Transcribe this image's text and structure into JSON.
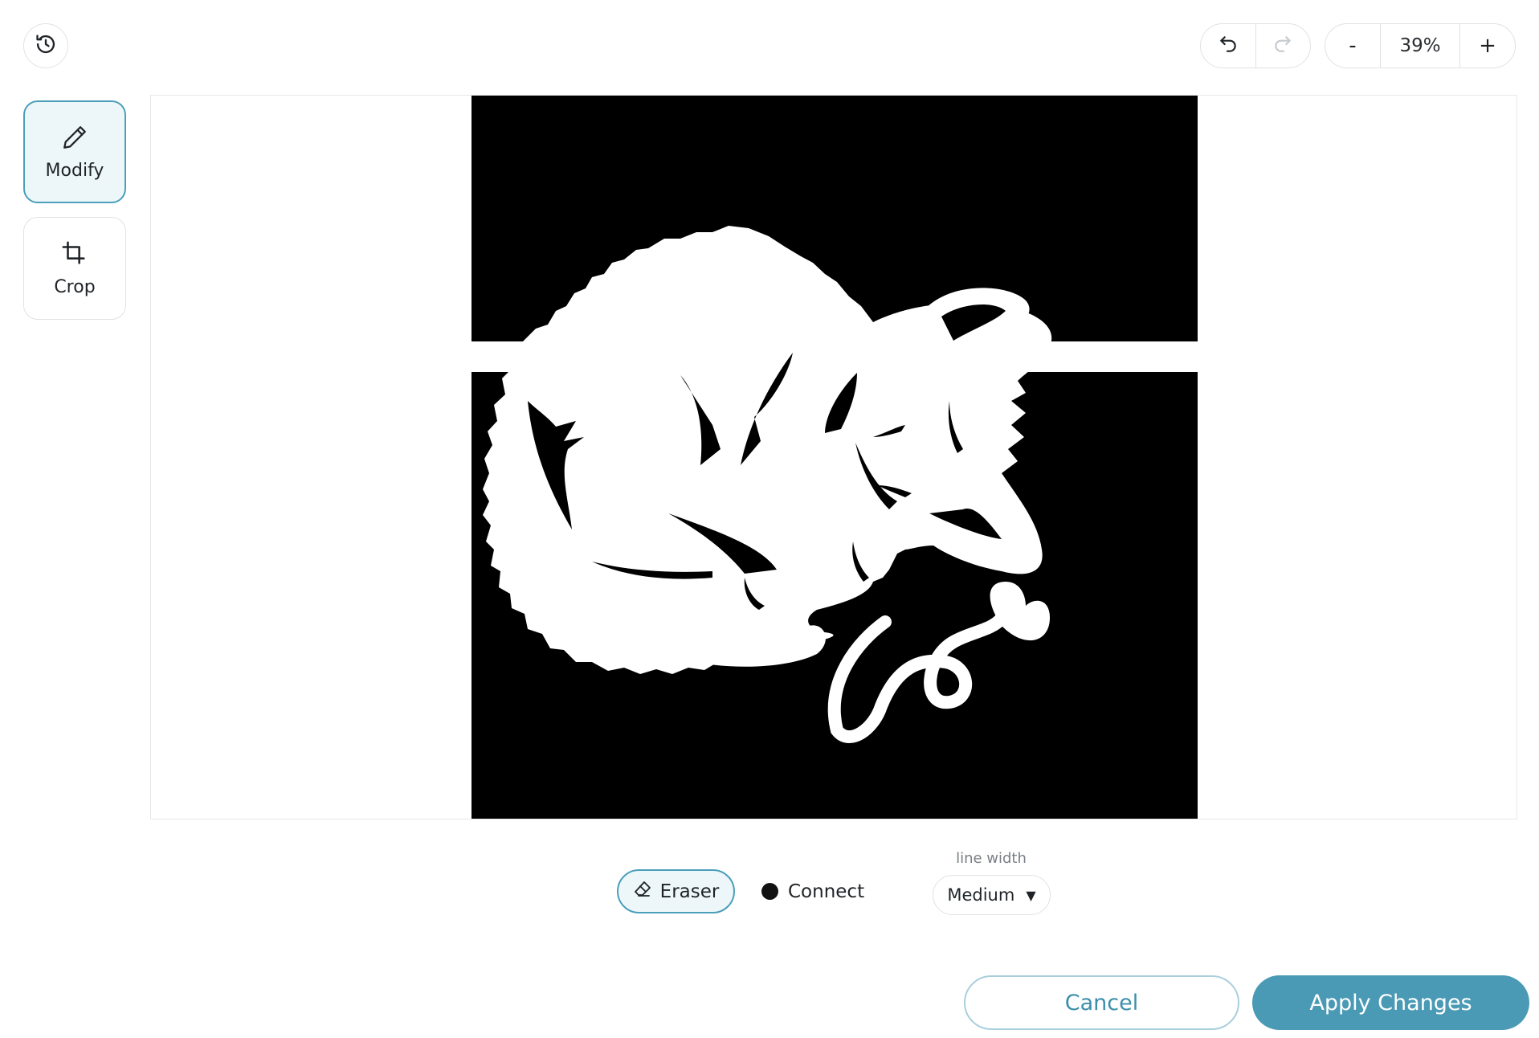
{
  "header": {
    "history_icon": "history-icon",
    "undo_icon": "undo-icon",
    "redo_icon": "redo-icon",
    "zoom": {
      "minus_label": "-",
      "value": "39%",
      "plus_label": "+"
    }
  },
  "tools": [
    {
      "label": "Modify",
      "icon": "pencil-icon",
      "active": true
    },
    {
      "label": "Crop",
      "icon": "crop-icon",
      "active": false
    }
  ],
  "canvas": {
    "image_alt": "sleeping cat silhouette"
  },
  "bottom_tools": {
    "eraser_label": "Eraser",
    "connect_label": "Connect",
    "line_width_label": "line width",
    "line_width_value": "Medium"
  },
  "actions": {
    "cancel_label": "Cancel",
    "apply_label": "Apply Changes"
  },
  "colors": {
    "accent": "#4a9ab5",
    "accent_light": "#edf7fa",
    "border": "#dfe2e6"
  }
}
